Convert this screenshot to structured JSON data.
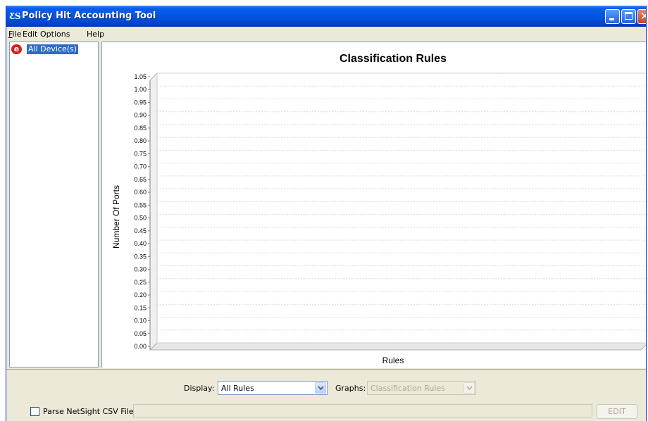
{
  "window": {
    "title": "Policy Hit Accounting Tool",
    "app_icon_glyph": "ƸS"
  },
  "menu": [
    {
      "label": "File",
      "mnemonic": "F"
    },
    {
      "label": "Edit"
    },
    {
      "label": "Options"
    },
    {
      "label": "Help"
    }
  ],
  "tree": {
    "root_label": "All Device(s)",
    "root_icon": "e"
  },
  "chart_data": {
    "type": "bar",
    "title": "Classification Rules",
    "xlabel": "Rules",
    "ylabel": "Number Of Ports",
    "categories": [],
    "values": [],
    "ylim": [
      0,
      1.05
    ],
    "yticks": [
      "0.00",
      "0.05",
      "0.10",
      "0.15",
      "0.20",
      "0.25",
      "0.30",
      "0.35",
      "0.40",
      "0.45",
      "0.50",
      "0.55",
      "0.60",
      "0.65",
      "0.70",
      "0.75",
      "0.80",
      "0.85",
      "0.90",
      "0.95",
      "1.00",
      "1.05"
    ],
    "grid": true,
    "plot_background": "#ffffff",
    "grid_color": "#d9d9d9"
  },
  "controls": {
    "display_label": "Display:",
    "display_value": "All Rules",
    "graphs_label": "Graphs:",
    "graphs_value": "Classification Rules",
    "parse_label": "Parse NetSight CSV File:",
    "parse_checked": false,
    "path_value": "",
    "edit_button": "EDIT"
  },
  "colors": {
    "titlebar": "#0055e5",
    "window_bg": "#ece9d8",
    "selection": "#316ac5",
    "close_button": "#c6441f"
  }
}
